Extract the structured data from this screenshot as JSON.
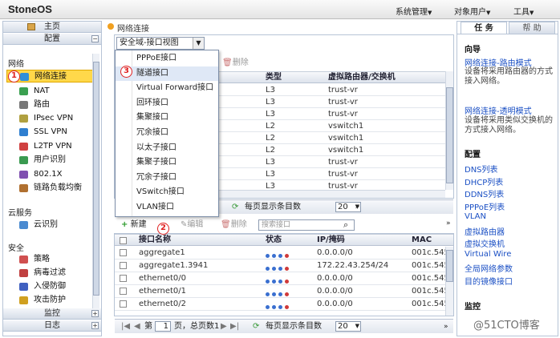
{
  "app": {
    "name": "StoneOS"
  },
  "topmenu": [
    {
      "label": "系统管理"
    },
    {
      "label": "对象用户"
    },
    {
      "label": "工具"
    }
  ],
  "sidebar": {
    "home": "主页",
    "config": "配置",
    "section_network": "网络",
    "network_items": [
      {
        "label": "网络连接",
        "icon": "network-icon",
        "color": "#2f8fd8"
      },
      {
        "label": "NAT",
        "icon": "nat-icon",
        "color": "#3aa050"
      },
      {
        "label": "路由",
        "icon": "route-icon",
        "color": "#777777"
      },
      {
        "label": "IPsec VPN",
        "icon": "ipsec-icon",
        "color": "#b0a040"
      },
      {
        "label": "SSL VPN",
        "icon": "ssl-icon",
        "color": "#2f7fd0"
      },
      {
        "label": "L2TP VPN",
        "icon": "l2tp-icon",
        "color": "#d04040"
      },
      {
        "label": "用户识别",
        "icon": "user-icon",
        "color": "#3a9a50"
      },
      {
        "label": "802.1X",
        "icon": "dot1x-icon",
        "color": "#8050b0"
      },
      {
        "label": "链路负载均衡",
        "icon": "balance-icon",
        "color": "#b07030"
      }
    ],
    "section_cloud": "云服务",
    "cloud_items": [
      {
        "label": "云识别",
        "icon": "cloud-icon",
        "color": "#4a8ad0"
      }
    ],
    "section_security": "安全",
    "security_items": [
      {
        "label": "策略",
        "icon": "policy-icon",
        "color": "#d05050"
      },
      {
        "label": "病毒过滤",
        "icon": "virus-icon",
        "color": "#c04040"
      },
      {
        "label": "入侵防御",
        "icon": "ips-icon",
        "color": "#4060c0"
      },
      {
        "label": "攻击防护",
        "icon": "attack-icon",
        "color": "#d0a020"
      }
    ],
    "monitor": "监控",
    "log": "日志"
  },
  "breadcrumb": "网络连接",
  "top_panel": {
    "view_select": "安全域-接口视图",
    "delete": "删除",
    "columns": {
      "type": "类型",
      "vrouter": "虚拟路由器/交换机"
    },
    "rows": [
      {
        "type": "L3",
        "vr": "trust-vr"
      },
      {
        "type": "L3",
        "vr": "trust-vr"
      },
      {
        "type": "L3",
        "vr": "trust-vr"
      },
      {
        "type": "L2",
        "vr": "vswitch1"
      },
      {
        "type": "L2",
        "vr": "vswitch1"
      },
      {
        "type": "L2",
        "vr": "vswitch1"
      },
      {
        "type": "L3",
        "vr": "trust-vr"
      },
      {
        "type": "L3",
        "vr": "trust-vr"
      },
      {
        "type": "L3",
        "vr": "trust-vr"
      }
    ],
    "pager_per_page": "每页显示条目数",
    "pager_value": "20"
  },
  "dropdown": {
    "items": [
      "PPPoE接口",
      "隧道接口",
      "Virtual Forward接口",
      "回环接口",
      "集聚接口",
      "冗余接口",
      "以太子接口",
      "集聚子接口",
      "冗余子接口",
      "VSwitch接口",
      "VLAN接口"
    ],
    "highlight": 1
  },
  "badges": {
    "one": "1",
    "two": "2",
    "three": "3"
  },
  "bottom_panel": {
    "new": "新建",
    "edit": "编辑",
    "delete": "删除",
    "search_placeholder": "搜索接口",
    "columns": {
      "name": "接口名称",
      "status": "状态",
      "ip": "IP/掩码",
      "mac": "MAC"
    },
    "rows": [
      {
        "name": "aggregate1",
        "ip": "0.0.0.0/0",
        "mac": "001c.545"
      },
      {
        "name": "aggregate1.3941",
        "ip": "172.22.43.254/24",
        "mac": "001c.545"
      },
      {
        "name": "ethernet0/0",
        "ip": "0.0.0.0/0",
        "mac": "001c.545"
      },
      {
        "name": "ethernet0/1",
        "ip": "0.0.0.0/0",
        "mac": "001c.545"
      },
      {
        "name": "ethernet0/2",
        "ip": "0.0.0.0/0",
        "mac": "001c.545"
      }
    ],
    "pager_page": "第",
    "pager_page_value": "1",
    "pager_total": "页，总页数1",
    "pager_per_page": "每页显示条目数",
    "pager_value": "20"
  },
  "right_panel": {
    "tab_task": "任 务",
    "tab_help": "帮 助",
    "guide_title": "向导",
    "guide1_link": "网络连接-路由模式",
    "guide1_desc": "设备将采用路由器的方式接入网络。",
    "guide2_link": "网络连接-透明模式",
    "guide2_desc": "设备将采用类似交换机的方式接入网络。",
    "config_title": "配置",
    "config_links": [
      "DNS列表",
      "DHCP列表",
      "DDNS列表",
      "PPPoE列表",
      "VLAN",
      "虚拟路由器",
      "虚拟交换机",
      "Virtual Wire",
      "全局网络参数",
      "目的镜像接口"
    ],
    "monitor_title": "监控"
  },
  "watermark": "@51CTO博客"
}
